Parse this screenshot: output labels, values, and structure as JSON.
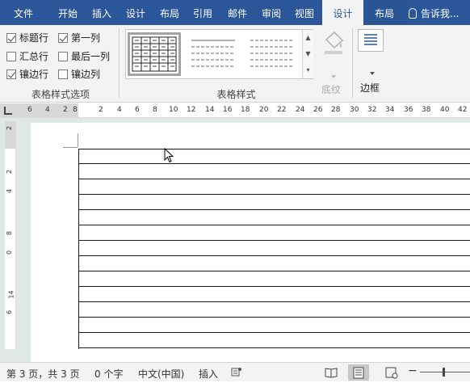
{
  "tabs": [
    "文件",
    "开始",
    "插入",
    "设计",
    "布局",
    "引用",
    "邮件",
    "审阅",
    "视图",
    "设计",
    "布局"
  ],
  "tell_me": "告诉我...",
  "options": {
    "header_row": "标题行",
    "first_column": "第一列",
    "total_row": "汇总行",
    "last_column": "最后一列",
    "banded_rows": "镶边行",
    "banded_columns": "镶边列",
    "group_label": "表格样式选项"
  },
  "checked": {
    "header_row": true,
    "first_column": true,
    "total_row": false,
    "last_column": false,
    "banded_rows": true,
    "banded_columns": false
  },
  "styles": {
    "group_label": "表格样式"
  },
  "shading": {
    "label": "底纹"
  },
  "borders": {
    "label": "边框"
  },
  "ruler": {
    "h_left": [
      "6",
      "4",
      "2",
      "8"
    ],
    "h_right": [
      "2",
      "4",
      "6",
      "8",
      "10",
      "12",
      "14",
      "16",
      "18",
      "20",
      "22",
      "24",
      "26",
      "28",
      "30",
      "32",
      "34",
      "36",
      "38",
      "40",
      "42"
    ],
    "v": [
      "2",
      "2",
      "4",
      "8",
      "0",
      "14",
      "6"
    ]
  },
  "status": {
    "page": "第 3 页，共 3 页",
    "words": "0 个字",
    "language": "中文(中国)",
    "mode": "插入"
  },
  "colors": {
    "ribbon_blue": "#2b579a",
    "workspace": "#dfe8e4"
  }
}
